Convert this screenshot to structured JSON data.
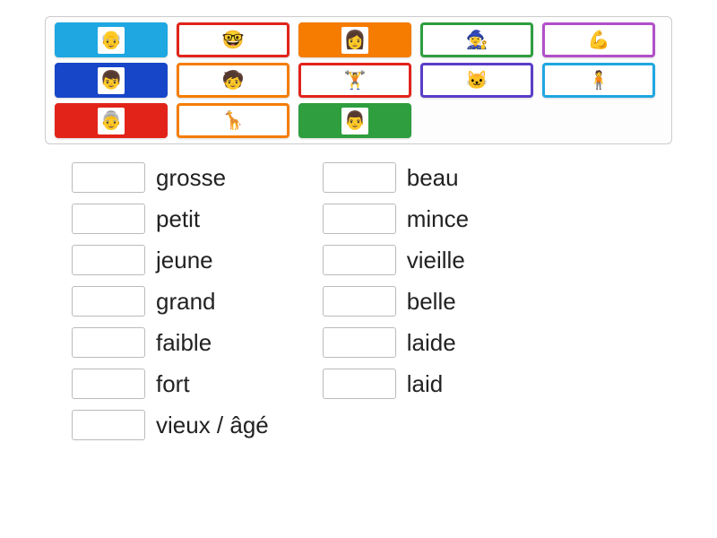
{
  "tiles": {
    "rows": [
      [
        {
          "bg": "#1ea7e1",
          "border": "#1ea7e1",
          "icon": "old-man-face",
          "emoji": "👴"
        },
        {
          "bg": "#ffffff",
          "border": "#e2231a",
          "icon": "nerd-face",
          "emoji": "🤓"
        },
        {
          "bg": "#f57c00",
          "border": "#f57c00",
          "icon": "woman-face",
          "emoji": "👩"
        },
        {
          "bg": "#ffffff",
          "border": "#2e9e3f",
          "icon": "witch-face",
          "emoji": "🧙‍♀️"
        },
        {
          "bg": "#ffffff",
          "border": "#b14fc9",
          "icon": "strong-person",
          "emoji": "💪"
        }
      ],
      [
        {
          "bg": "#1746c9",
          "border": "#1746c9",
          "icon": "small-boy",
          "emoji": "👦"
        },
        {
          "bg": "#ffffff",
          "border": "#f57c00",
          "icon": "child-playing",
          "emoji": "🧒"
        },
        {
          "bg": "#ffffff",
          "border": "#e2231a",
          "icon": "athletic-person",
          "emoji": "🏋️"
        },
        {
          "bg": "#ffffff",
          "border": "#5a3ec8",
          "icon": "skinny-person",
          "emoji": "🐱"
        },
        {
          "bg": "#ffffff",
          "border": "#1ea7e1",
          "icon": "large-person",
          "emoji": "🧍"
        }
      ],
      [
        {
          "bg": "#e2231a",
          "border": "#e2231a",
          "icon": "old-woman-face",
          "emoji": "👵"
        },
        {
          "bg": "#ffffff",
          "border": "#f57c00",
          "icon": "tall-thin-person",
          "emoji": "🦒"
        },
        {
          "bg": "#2e9e3f",
          "border": "#2e9e3f",
          "icon": "young-man-face",
          "emoji": "👨"
        }
      ]
    ]
  },
  "answers": {
    "left": [
      {
        "label": "grosse"
      },
      {
        "label": "petit"
      },
      {
        "label": "jeune"
      },
      {
        "label": "grand"
      },
      {
        "label": "faible"
      },
      {
        "label": "fort"
      },
      {
        "label": "vieux / âgé"
      }
    ],
    "right": [
      {
        "label": "beau"
      },
      {
        "label": "mince"
      },
      {
        "label": "vieille"
      },
      {
        "label": "belle"
      },
      {
        "label": "laide"
      },
      {
        "label": "laid"
      }
    ]
  }
}
